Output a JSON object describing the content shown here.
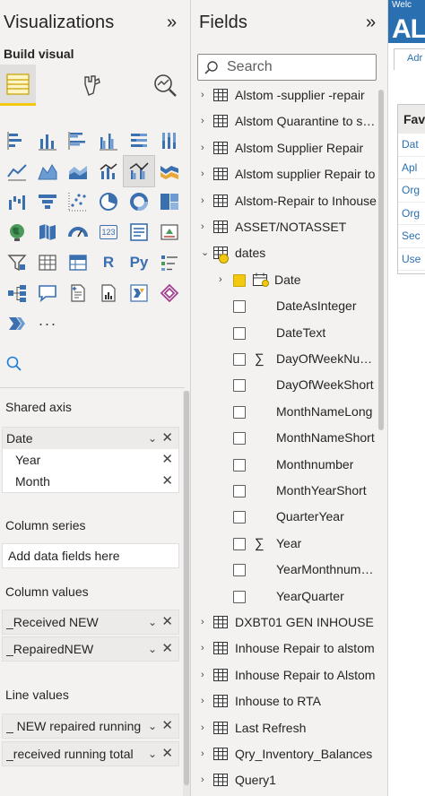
{
  "visualizations": {
    "title": "Visualizations",
    "collapse_glyph": "»",
    "build_label": "Build visual",
    "tabs": [
      {
        "name": "build-visual-tab",
        "icon": "table-fields-icon",
        "selected": true
      },
      {
        "name": "format-visual-tab",
        "icon": "paintbrush-icon",
        "selected": false
      },
      {
        "name": "analytics-tab",
        "icon": "magnifier-chart-icon",
        "selected": false
      }
    ],
    "gallery_icons": [
      "stacked-bar-icon",
      "stacked-column-icon",
      "clustered-bar-icon",
      "clustered-column-icon",
      "100-bar-icon",
      "100-column-icon",
      "line-chart-icon",
      "area-chart-icon",
      "stacked-area-icon",
      "line-column-icon",
      "line-clustered-column-icon",
      "ribbon-chart-icon",
      "waterfall-icon",
      "funnel-icon",
      "scatter-icon",
      "pie-icon",
      "donut-icon",
      "treemap-icon",
      "map-icon",
      "filled-map-icon",
      "gauge-icon",
      "card-icon",
      "multi-row-card-icon",
      "kpi-icon",
      "slicer-icon",
      "table-icon",
      "matrix-icon",
      "r-script-icon",
      "python-icon",
      "key-influencers-icon",
      "decomposition-tree-icon",
      "qa-icon",
      "smart-narrative-icon",
      "paginated-report-icon",
      "power-automate-icon",
      "power-apps-icon",
      "chevron-visual-icon",
      "more-visuals-icon"
    ],
    "r_label": "R",
    "py_label": "Py",
    "card_label": "123",
    "more_label": "···",
    "wells": {
      "shared_axis": {
        "label": "Shared axis",
        "field": "Date",
        "children": [
          "Year",
          "Month"
        ]
      },
      "column_series": {
        "label": "Column series",
        "placeholder": "Add data fields here"
      },
      "column_values": {
        "label": "Column values",
        "fields": [
          "_Received NEW",
          "_RepairedNEW"
        ]
      },
      "line_values": {
        "label": "Line values",
        "fields": [
          "_ NEW repaired running total",
          "_received running total"
        ]
      }
    },
    "chevron_glyph": "⌄",
    "remove_glyph": "✕"
  },
  "fields": {
    "title": "Fields",
    "collapse_glyph": "»",
    "search_placeholder": "Search",
    "tables_before": [
      "Alstom -supplier -repair",
      "Alstom Quarantine to supplier",
      "Alstom Supplier Repair",
      "Alstom supplier Repair to",
      "Alstom-Repair to Inhouse",
      "ASSET/NOTASSET"
    ],
    "dates_table": {
      "name": "dates",
      "hierarchy": "Date",
      "columns": [
        {
          "name": "DateAsInteger",
          "sigma": false
        },
        {
          "name": "DateText",
          "sigma": false
        },
        {
          "name": "DayOfWeekNumber",
          "sigma": true
        },
        {
          "name": "DayOfWeekShort",
          "sigma": false
        },
        {
          "name": "MonthNameLong",
          "sigma": false
        },
        {
          "name": "MonthNameShort",
          "sigma": false
        },
        {
          "name": "Monthnumber",
          "sigma": false
        },
        {
          "name": "MonthYearShort",
          "sigma": false
        },
        {
          "name": "QuarterYear",
          "sigma": false
        },
        {
          "name": "Year",
          "sigma": true
        },
        {
          "name": "YearMonthnumber",
          "sigma": false
        },
        {
          "name": "YearQuarter",
          "sigma": false
        }
      ]
    },
    "tables_after": [
      "DXBT01 GEN INHOUSE",
      "Inhouse Repair to alstom",
      "Inhouse Repair to Alstom",
      "Inhouse to RTA",
      "Last Refresh",
      "Qry_Inventory_Balances",
      "Query1"
    ],
    "sigma_glyph": "∑",
    "expand_glyph": "›",
    "expanded_glyph": "⌄"
  },
  "canvas": {
    "welcome": "Welc",
    "brand": "AL",
    "tab": "Adr",
    "panel_title": "Fav",
    "items": [
      "Dat",
      "Apl",
      "Org",
      "Org",
      "Sec",
      "Use"
    ]
  }
}
